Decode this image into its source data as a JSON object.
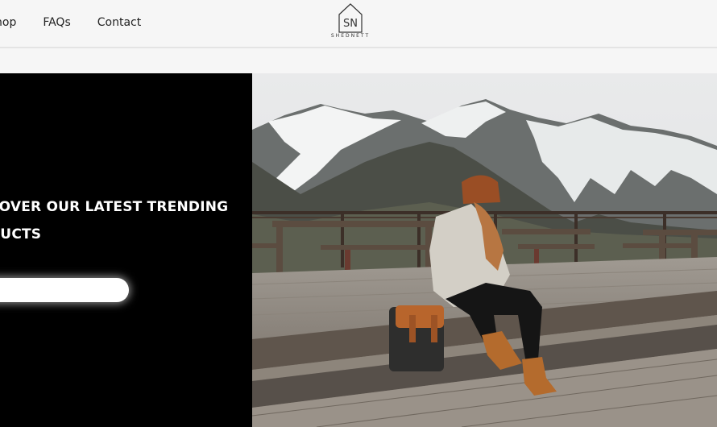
{
  "header": {
    "nav": [
      {
        "label": "hop"
      },
      {
        "label": "FAQs"
      },
      {
        "label": "Contact"
      }
    ],
    "logo": {
      "monogram": "SN",
      "wordmark": "SHEDNETT"
    }
  },
  "hero": {
    "headline_line1": "COVER OUR LATEST TRENDING",
    "headline_line2": "DUCTS",
    "cta_label": ""
  },
  "colors": {
    "background": "#f6f6f6",
    "hero_left": "#000000",
    "text": "#222222"
  }
}
